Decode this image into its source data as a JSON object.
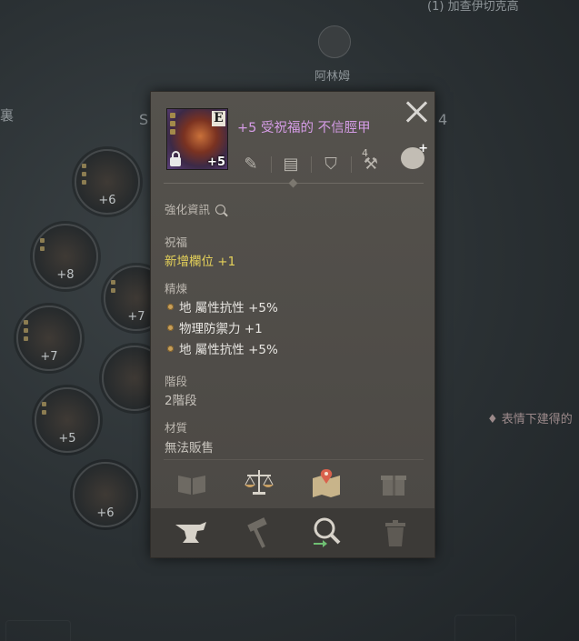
{
  "background": {
    "top_text": "加查伊切克高",
    "npc_name": "阿林姆",
    "side_letter_s": "S",
    "side_number": "4",
    "left_partial": "裏",
    "right_text": "表情下建得的",
    "slot_levels": [
      "+6",
      "+8",
      "+7",
      "+7",
      "+5",
      "+6"
    ]
  },
  "item": {
    "grade": "E",
    "enhance": "+5",
    "name": "+5 受祝福的 不信脛甲",
    "name_color": "#d59ce6",
    "icon_row_number": "4"
  },
  "sections": {
    "enhance_info_label": "強化資訊",
    "blessing_label": "祝福",
    "blessing_value": "新增欄位 +1",
    "refine_label": "精煉",
    "refine_stats": [
      "地 屬性抗性 +5%",
      "物理防禦力 +1",
      "地 屬性抗性 +5%"
    ],
    "stage_label": "階段",
    "stage_value": "2階段",
    "material_label": "材質",
    "material_value": "無法販售"
  },
  "colors": {
    "gold": "#e6d25a",
    "panel": "#504d49",
    "footer": "#3c3a37"
  }
}
